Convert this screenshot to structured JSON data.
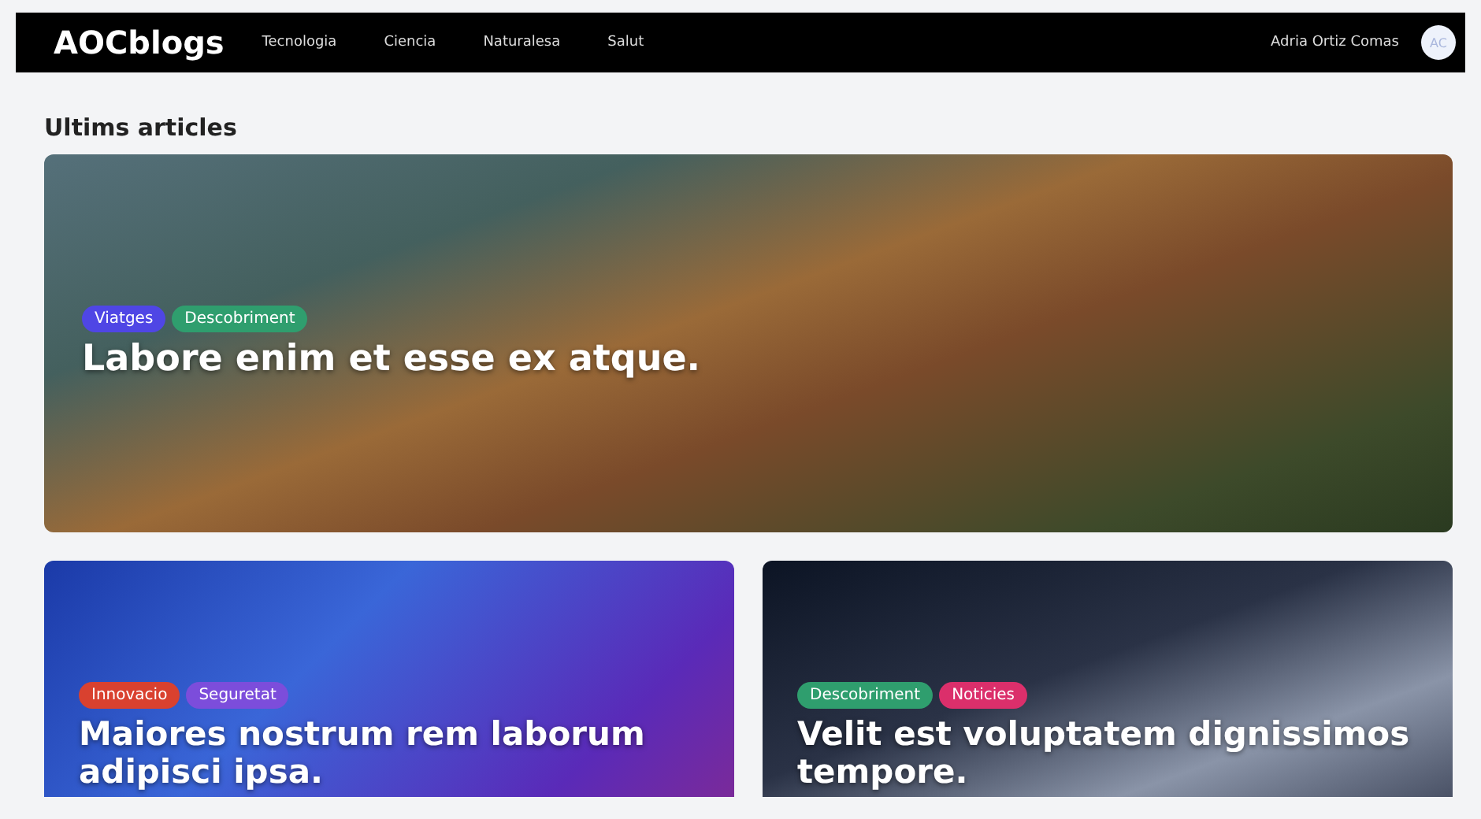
{
  "navbar": {
    "logo": "AOCblogs",
    "links": [
      "Tecnologia",
      "Ciencia",
      "Naturalesa",
      "Salut"
    ],
    "user_name": "Adria Ortiz Comas",
    "avatar_initials": "AC"
  },
  "section_title": "Ultims articles",
  "featured": {
    "tags": [
      {
        "label": "Viatges",
        "color": "#4f46e5"
      },
      {
        "label": "Descobriment",
        "color": "#2f9e6e"
      }
    ],
    "title": "Labore enim et esse ex atque."
  },
  "articles": [
    {
      "tags": [
        {
          "label": "Innovacio",
          "color": "#d9412f"
        },
        {
          "label": "Seguretat",
          "color": "#7c4ddb"
        }
      ],
      "title": "Maiores nostrum rem laborum adipisci ipsa."
    },
    {
      "tags": [
        {
          "label": "Descobriment",
          "color": "#2f9e6e"
        },
        {
          "label": "Noticies",
          "color": "#db2f6b"
        }
      ],
      "title": "Velit est voluptatem dignissimos tempore."
    }
  ]
}
